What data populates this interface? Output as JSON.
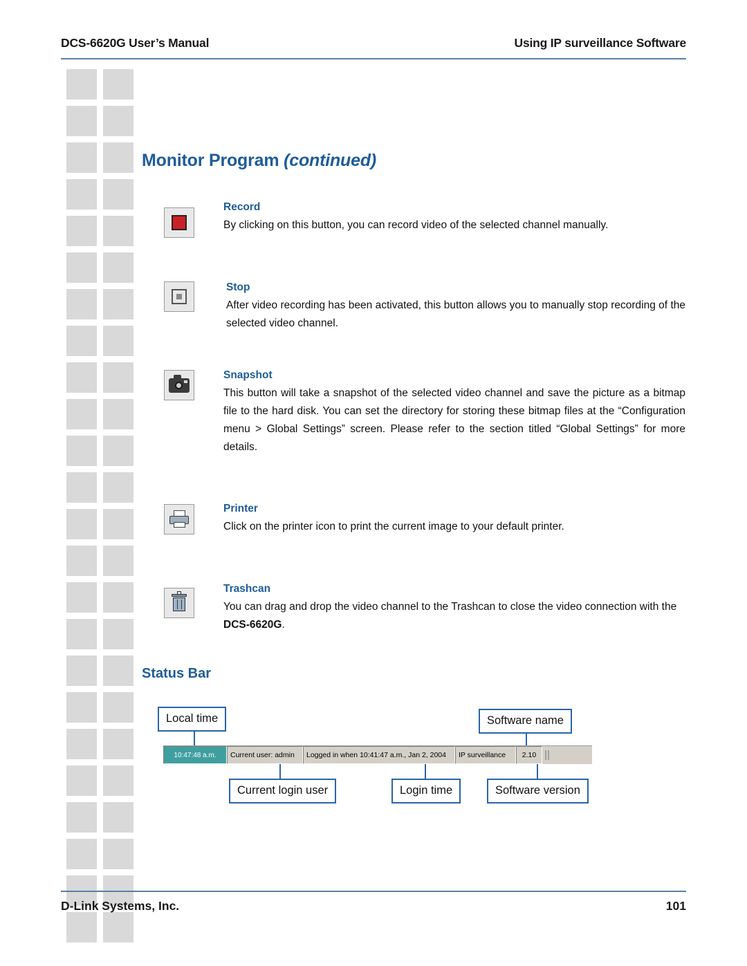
{
  "header": {
    "left": "DCS-6620G User’s Manual",
    "right": "Using IP surveillance Software"
  },
  "title": {
    "main": "Monitor Program ",
    "continued": "(continued)"
  },
  "entries": [
    {
      "id": "record",
      "icon": "record-icon",
      "title": "Record",
      "body": "By clicking on this button, you can record video of the selected channel manually."
    },
    {
      "id": "stop",
      "icon": "stop-icon",
      "title": "Stop",
      "body": "After video recording has been activated, this button allows you to manually stop recording of the selected video channel."
    },
    {
      "id": "snapshot",
      "icon": "camera-icon",
      "title": "Snapshot",
      "body": "This button will take a snapshot of the selected video channel and save the picture as a bitmap file to the hard disk. You can set the directory for storing these bitmap files at the “Configuration menu > Global Settings” screen. Please refer to the section titled “Global Settings” for more details."
    },
    {
      "id": "printer",
      "icon": "printer-icon",
      "title": "Printer",
      "body": "Click on the printer icon to print the current image to your default printer."
    },
    {
      "id": "trashcan",
      "icon": "trashcan-icon",
      "title": "Trashcan",
      "body_prefix": "You can drag and drop the video channel to the Trashcan to close the video connection with the ",
      "body_bold": "DCS-6620G",
      "body_suffix": "."
    }
  ],
  "status_bar_section": {
    "heading": "Status Bar",
    "callouts": {
      "local_time": "Local time",
      "software_name": "Software name",
      "current_login_user": "Current login user",
      "login_time": "Login time",
      "software_version": "Software version"
    },
    "statusbar_cells": {
      "time": "10:47:48 a.m.",
      "user": "Current user: admin",
      "login": "Logged in when 10:41:47 a.m., Jan 2, 2004",
      "name": "IP surveillance",
      "version": "2.10"
    }
  },
  "footer": {
    "left": "D-Link Systems, Inc.",
    "right": "101"
  },
  "colors": {
    "accent_blue": "#1f5c99",
    "rule_blue": "#5b7fa6",
    "callout_border": "#2a64a8",
    "status_time_bg": "#3f9f9f"
  }
}
